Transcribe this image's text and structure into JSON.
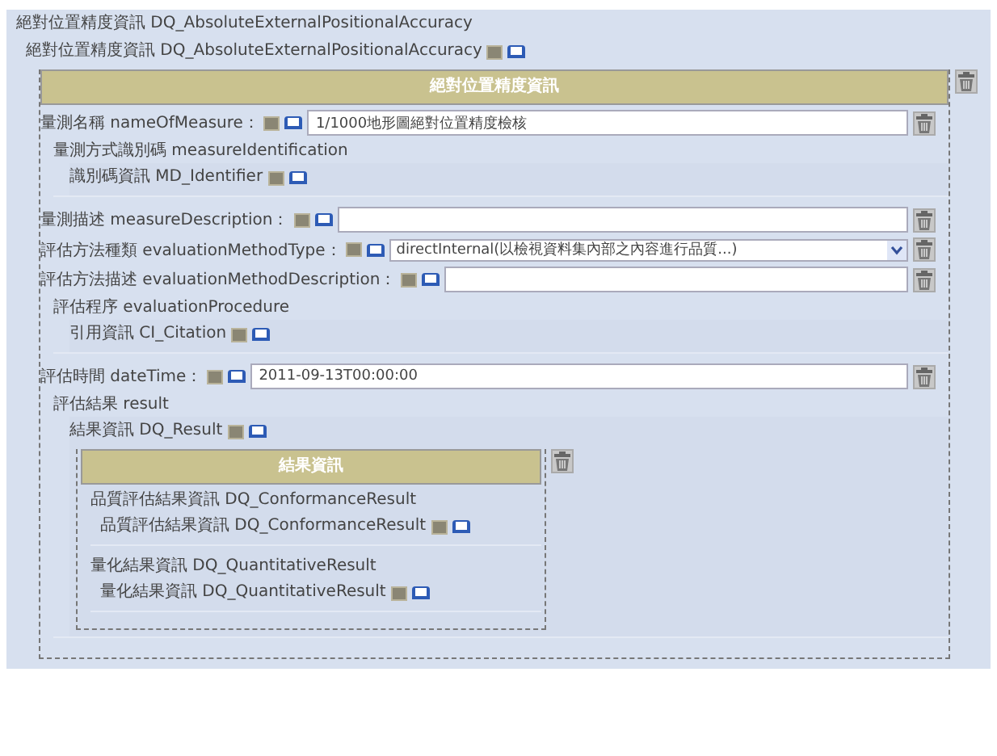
{
  "title": "絕對位置精度資訊 DQ_AbsoluteExternalPositionalAccuracy",
  "element": {
    "label": "絕對位置精度資訊 DQ_AbsoluteExternalPositionalAccuracy"
  },
  "section": {
    "header": "絕對位置精度資訊",
    "items": [
      {
        "kind": "field",
        "label": "量測名稱 nameOfMeasure：",
        "value": "1/1000地形圖絕對位置精度檢核"
      },
      {
        "kind": "group",
        "label": "量測方式識別碼 measureIdentification",
        "children": [
          {
            "label": "識別碼資訊 MD_Identifier"
          }
        ]
      },
      {
        "kind": "field",
        "label": "量測描述 measureDescription："
      },
      {
        "kind": "select",
        "label": "評估方法種類 evaluationMethodType：",
        "value": "directInternal(以檢視資料集內部之內容進行品質...)"
      },
      {
        "kind": "field",
        "label": "評估方法描述 evaluationMethodDescription："
      },
      {
        "kind": "group",
        "label": "評估程序 evaluationProcedure",
        "children": [
          {
            "label": "引用資訊 CI_Citation"
          }
        ]
      },
      {
        "kind": "field",
        "label": "評估時間 dateTime：",
        "value": "2011-09-13T00:00:00"
      },
      {
        "kind": "group",
        "label": "評估結果 result",
        "children": [
          {
            "label": "結果資訊 DQ_Result",
            "section": {
              "header": "結果資訊",
              "groups": [
                {
                  "label": "品質評估結果資訊 DQ_ConformanceResult",
                  "children": [
                    {
                      "label": "品質評估結果資訊 DQ_ConformanceResult"
                    }
                  ]
                },
                {
                  "label": "量化結果資訊 DQ_QuantitativeResult",
                  "children": [
                    {
                      "label": "量化結果資訊 DQ_QuantitativeResult"
                    }
                  ]
                }
              ]
            }
          }
        ]
      }
    ]
  }
}
